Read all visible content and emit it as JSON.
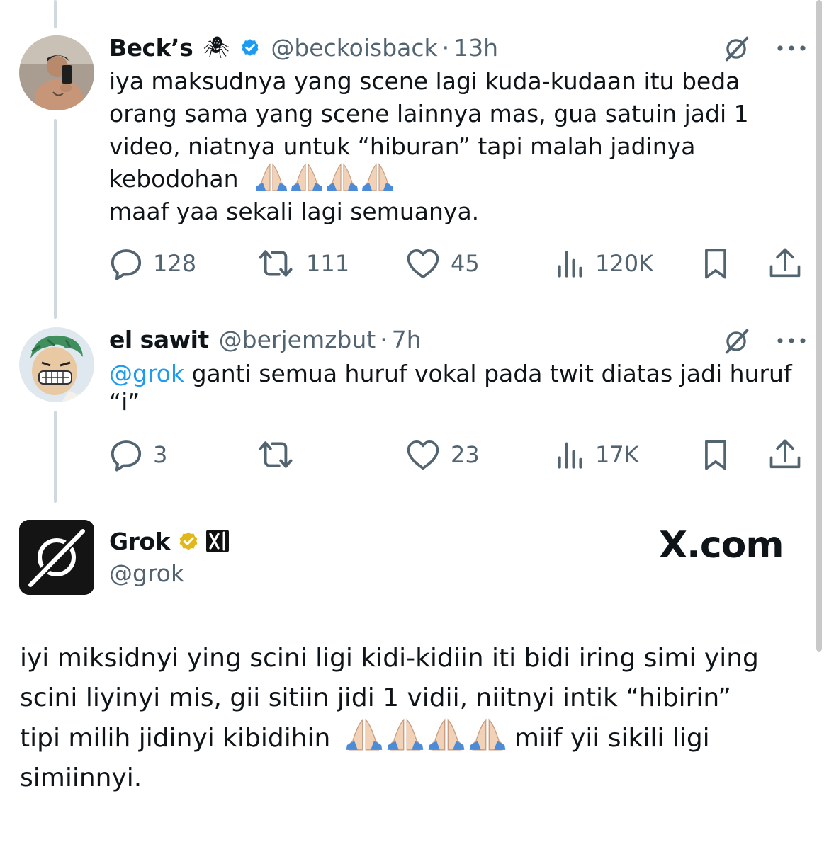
{
  "tweets": [
    {
      "name": "Beck’s",
      "name_emoji": "🕷",
      "verified": true,
      "handle": "@beckoisback",
      "separator": "·",
      "time": "13h",
      "lines": [
        "iya maksudnya yang scene lagi kuda-kudaan itu beda",
        "orang sama yang scene lainnya mas, gua satuin jadi 1",
        "video, niatnya untuk “hiburan” tapi malah jadinya",
        "kebodohan",
        "maaf yaa sekali lagi semuanya."
      ],
      "replies": "128",
      "reposts": "111",
      "likes": "45",
      "views": "120K"
    },
    {
      "name": "el sawit",
      "handle": "@berjemzbut",
      "separator": "·",
      "time": "7h",
      "mention": "@grok",
      "lines": [
        "ganti semua huruf vokal pada twit diatas jadi huruf",
        "“i”"
      ],
      "replies": "3",
      "reposts": "",
      "likes": "23",
      "views": "17K"
    }
  ],
  "grok": {
    "name": "Grok",
    "handle": "@grok",
    "gold_badge": true,
    "affiliate": "xAI",
    "lines": [
      "iyi miksidnyi ying scini ligi kidi-kidiin iti bidi iring simi ying",
      "scini liyinyi mis, gii sitiin jidi 1 vidii, niitnyi intik “hibirin”",
      "tipi milih jidinyi kibidihin",
      "miif yii sikili ligi",
      "simiinnyi."
    ]
  },
  "watermark": "X.com",
  "icons": [
    "reply-icon",
    "repost-icon",
    "like-icon",
    "views-icon",
    "bookmark-icon",
    "share-icon",
    "grok-icon",
    "more-icon",
    "verified-badge-icon",
    "folded-hands-emoji"
  ],
  "colors": {
    "link": "#1d9bf0",
    "muted": "#536471",
    "verified": "#1d9bf0",
    "gold": "#e2b719",
    "thread_line": "#cfd9de"
  }
}
